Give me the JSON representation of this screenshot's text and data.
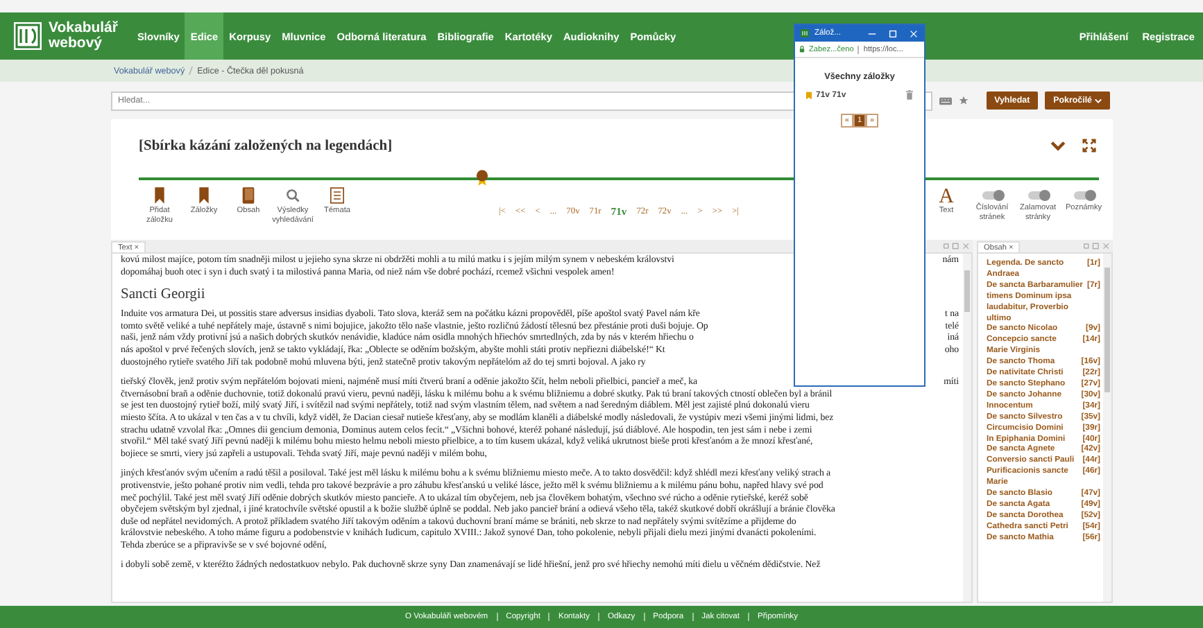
{
  "header": {
    "logo_text": "Vokabulář webový",
    "nav": [
      {
        "label": "Slovníky",
        "selected": false
      },
      {
        "label": "Edice",
        "selected": true
      },
      {
        "label": "Korpusy",
        "selected": false
      },
      {
        "label": "Mluvnice",
        "selected": false
      },
      {
        "label": "Odborná literatura",
        "selected": false
      },
      {
        "label": "Bibliografie",
        "selected": false
      },
      {
        "label": "Kartotéky",
        "selected": false
      },
      {
        "label": "Audioknihy",
        "selected": false
      },
      {
        "label": "Pomůcky",
        "selected": false
      }
    ],
    "account": [
      "Přihlášení",
      "Registrace"
    ]
  },
  "breadcrumb": [
    "Vokabulář webový",
    "Edice - Čtečka děl pokusná"
  ],
  "search": {
    "placeholder": "Hledat...",
    "buttons": [
      "Vyhledat",
      "Pokročilé"
    ]
  },
  "work": {
    "title": "[Sbírka kázání založených na legendách]",
    "position": {
      "level": 0.355
    },
    "tools": [
      {
        "label": "Přidat záložku",
        "kind": "bookmark"
      },
      {
        "label": "Záložky",
        "kind": "bookmark"
      },
      {
        "label": "Obsah",
        "kind": "book"
      },
      {
        "label": "Výsledky vyhledávání",
        "kind": "search"
      },
      {
        "label": "Témata",
        "kind": "list"
      }
    ],
    "pager": [
      {
        "label": "|<",
        "selected": false
      },
      {
        "label": "<<",
        "selected": false
      },
      {
        "label": "<",
        "selected": false
      },
      {
        "label": "...",
        "selected": false
      },
      {
        "label": "70v",
        "selected": false
      },
      {
        "label": "71r",
        "selected": false
      },
      {
        "label": "71v",
        "selected": true
      },
      {
        "label": "72r",
        "selected": false
      },
      {
        "label": "72v",
        "selected": false
      },
      {
        "label": "...",
        "selected": false
      },
      {
        "label": ">",
        "selected": false
      },
      {
        "label": ">>",
        "selected": false
      },
      {
        "label": ">|",
        "selected": false
      }
    ],
    "display": [
      {
        "kind": "font",
        "icon": "A",
        "label": "Text"
      },
      {
        "kind": "toggle",
        "label": "Číslování stránek",
        "on": true
      },
      {
        "kind": "toggle",
        "label": "Zalamovat stránky",
        "on": true
      },
      {
        "kind": "toggle",
        "label": "Poznámky",
        "on": true
      }
    ]
  },
  "text_panel": {
    "tab": "Text",
    "close": "×",
    "blocks": [
      {
        "kind": "para",
        "lines": [
          {
            "text": "kovú milost majíce, potom tím snadněji milost u jejieho syna skrze ni obdržěti mohli a tu milú matku i s jejím milým synem v nebeském královstvi",
            "tail": "nám"
          },
          {
            "text": "dopomáhaj buoh otec i syn i duch svatý i ta milostivá panna Maria, od niež nám vše dobré pochází, rcemež všichni vespolek amen!"
          }
        ]
      },
      {
        "kind": "heading",
        "text": "Sancti Georgii"
      },
      {
        "kind": "para",
        "lines": [
          {
            "text": "Induite vos armatura Dei, ut possitis stare adversus insidias dyaboli. Tato slova, kteráž sem na počátku kázni propověděl, píše apoštol svatý Pavel nám kře",
            "tail": "t na"
          },
          {
            "text": "tomto světě veliké a tuhé nepřátely maje, ústavně s nimi bojujice, jakožto tělo naše vlastnie, ješto rozličnú žádostí tělesnú bez přestánie proti duši bojuje. Op",
            "tail": "telé"
          },
          {
            "text": "naši, jenž nám vždy protivní jsú a našich dobrých skutkóv nenávidie, kladúce nám osidla mnohých hřiechóv smrtedlných, zda by nás v kterém hřiechu o",
            "tail": "iná"
          },
          {
            "text": "nás apoštol v prvé řečených slovích, jenž se takto vykládají, řka: „Oblecte se oděním božským, abyšte mohli státi protiv nepřiezni diábelské!“ Kt",
            "tail": "oho"
          },
          {
            "text": "duostojného rytieře svatého Jiří tak podobně mohú mluvena býti, jenž statečně protiv takovým nepřátelóm až do tej smrti bojoval. A jako ry"
          }
        ]
      },
      {
        "kind": "para",
        "lines": [
          {
            "text": "tieřský člověk, jenž protiv svým nepřátelóm bojovati mieni, najméně musí míti čtverú braní a oděnie jakožto ščít, helm neboli přielbici, pancieř a meč, ka",
            "tail": "míti"
          },
          {
            "text": "čtvernásobní braň a oděnie duchovnie, totiž dokonalú pravú vieru, pevnú naději, lásku k milému bohu a k svému bližniemu a dobré skutky. Pak tú braní takových ctností oblečen byl a bránil"
          },
          {
            "text": "se jest ten duostojný rytieř boží, milý svatý Jiří, i svítězil nad svými nepřátely, totiž nad svým vlastním tělem, nad světem a nad šeredným diáblem. Měl jest zajisté plnú dokonalú vieru"
          },
          {
            "text": "miesto ščíta. A to ukázal v ten čas a v tu chvíli, když viděl, že Dacian ciesař nutieše křesťany, aby se modlám klaněli a diábelské modly následovali, že vystúpiv mezi všemi jinými lidmi, bez"
          },
          {
            "text": "strachu udatně vzvolal řka: „Omnes dii gencium demonia, Dominus autem celos fecit.“ „Všichni bohové, kteréž pohané následují, jsú diáblové. Ale hospodin, ten jest sám i nebe i zemi"
          },
          {
            "text": "stvořil.“ Měl také svatý Jiří pevnú naději k milému bohu miesto helmu neboli miesto přielbice, a to tím kusem ukázal, když veliká ukrutnost bieše proti křesťanóm a že mnozí křesťané,"
          },
          {
            "text": "bojiece se smrti, viery jsú zapřeli a ustupovali. Tehda svatý Jiří, maje pevnú naději v milém bohu,"
          }
        ]
      },
      {
        "kind": "para",
        "lines": [
          {
            "text": "jiných křesťanóv svým učením a radú těšil a posiloval. Také jest měl lásku k milému bohu a k svému bližniemu miesto meče. A to takto dosvědčil: když shlédl mezi křesťany veliký strach a"
          },
          {
            "text": "protivenstvie, ješto pohané protiv nim vedli, tehda pro takové bezprávie a pro záhubu křesťanskú u veliké lásce, ježto měl k svému bližniemu a k milému pánu bohu, napřed hlavy své pod"
          },
          {
            "text": "meč pochýlil. Také jest měl svatý Jiří oděnie dobrých skutkóv miesto pancieře. A to ukázal tím obyčejem, neb jsa člověkem bohatým, všechno své rúcho a oděnie rytieřské, keréž sobě"
          },
          {
            "text": "obyčejem světským byl zjednal, i jiné kratochvíle světské opustil a k božie službě úplně se poddal. Neb jako pancieř brání a odievá všeho těla, takéž skutkové dobří okrášlují a bránie člověka"
          },
          {
            "text": "duše od nepřátel nevidomých. A protož příkladem svatého Jiří takovým oděním a takovú duchovní braní máme se brániti, neb skrze to nad nepřátely svými svítězíme a přijdeme do"
          },
          {
            "text": "královstvie nebeského. A toho máme figuru a podobenstvie v knihách Iudicum, capitulo XVIII.: Jakož synové Dan, toho pokolenie, nebyli přijali dielu mezi jinými dvanácti pokoleními."
          },
          {
            "text": "Tehda zberúce se a připravivše se v své bojovné odění,"
          }
        ]
      },
      {
        "kind": "para",
        "lines": [
          {
            "text": "i dobyli sobě země, v kteréžto žádných nedostatkuov nebylo. Pak duchovně skrze syny Dan znamenávají se lidé hřiešní, jenž pro své hřiechy nemohú míti dielu u věčném dědičstvie. Než"
          }
        ]
      }
    ]
  },
  "contents_panel": {
    "tab": "Obsah",
    "close": "×",
    "items": [
      {
        "title": "Legenda. De sancto Andraea",
        "page": "[1r]"
      },
      {
        "title": "De sancta Barbaramulier timens Dominum ipsa laudabitur, Proverbio ultimo",
        "page": "[7r]"
      },
      {
        "title": "De sancto Nicolao",
        "page": "[9v]"
      },
      {
        "title": "Concepcio sancte Marie Virginis",
        "page": "[14r]"
      },
      {
        "title": "De sancto Thoma",
        "page": "[16v]"
      },
      {
        "title": "De nativitate Christi",
        "page": "[22r]"
      },
      {
        "title": "De sancto Stephano",
        "page": "[27v]"
      },
      {
        "title": "De sancto Johanne",
        "page": "[30v]"
      },
      {
        "title": "Innocentum",
        "page": "[34r]"
      },
      {
        "title": "De sancto Silvestro",
        "page": "[35v]"
      },
      {
        "title": "Circumcisio Domini",
        "page": "[39r]"
      },
      {
        "title": "In Epiphania Domini",
        "page": "[40r]"
      },
      {
        "title": "De sancta Agnete",
        "page": "[42v]"
      },
      {
        "title": "Conversio sancti Pauli",
        "page": "[44r]"
      },
      {
        "title": "Purificacionis sancte Marie",
        "page": "[46r]"
      },
      {
        "title": "De sancto Blasio",
        "page": "[47v]"
      },
      {
        "title": "De sancta Agata",
        "page": "[49v]"
      },
      {
        "title": "De sancta Dorothea",
        "page": "[52v]"
      },
      {
        "title": "Cathedra sancti Petri",
        "page": "[54r]"
      },
      {
        "title": "De sancto Mathia",
        "page": "[56r]"
      }
    ]
  },
  "popup": {
    "title": "Zálož...",
    "security": "Zabez...čeno",
    "url": "https://loc...",
    "heading": "Všechny záložky",
    "bookmarks": [
      {
        "label": "71v 71v"
      }
    ],
    "pager": [
      {
        "label": "«",
        "selected": false
      },
      {
        "label": "1",
        "selected": true
      },
      {
        "label": "»",
        "selected": false
      }
    ]
  },
  "footer": [
    "O Vokabuláři webovém",
    "Copyright",
    "Kontakty",
    "Odkazy",
    "Podpora",
    "Jak citovat",
    "Připomínky"
  ]
}
